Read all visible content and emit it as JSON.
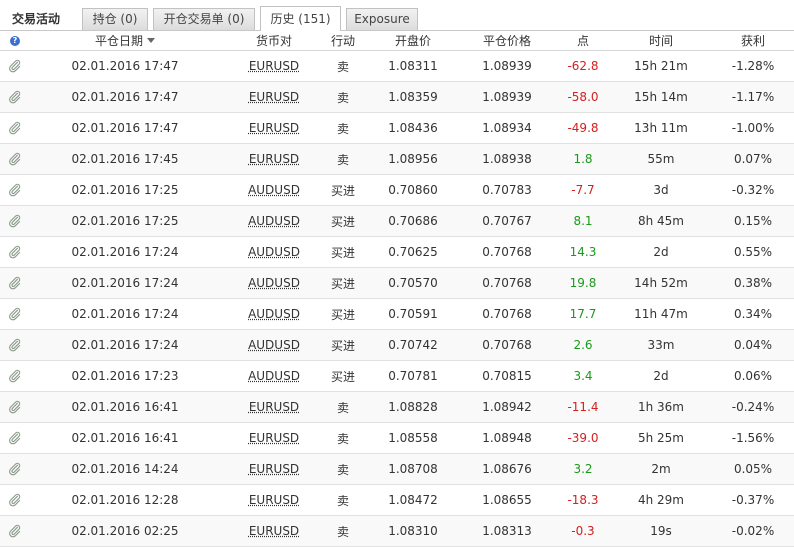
{
  "tabs": {
    "title": "交易活动",
    "items": [
      {
        "label": "持仓 (0)"
      },
      {
        "label": "开仓交易单 (0)"
      },
      {
        "label": "历史 (151)"
      },
      {
        "label": "Exposure"
      }
    ],
    "active_index": 2
  },
  "columns": {
    "close_date": "平仓日期",
    "pair": "货币对",
    "action": "行动",
    "open_price": "开盘价",
    "close_price": "平仓价格",
    "points": "点",
    "time": "时间",
    "pl": "获利"
  },
  "colors": {
    "negative": "#d42020",
    "positive": "#1a9a1a"
  },
  "rows": [
    {
      "date": "02.01.2016 17:47",
      "pair": "EURUSD",
      "action": "卖",
      "open": "1.08311",
      "close": "1.08939",
      "points": "-62.8",
      "time": "15h 21m",
      "pl": "-1.28%"
    },
    {
      "date": "02.01.2016 17:47",
      "pair": "EURUSD",
      "action": "卖",
      "open": "1.08359",
      "close": "1.08939",
      "points": "-58.0",
      "time": "15h 14m",
      "pl": "-1.17%"
    },
    {
      "date": "02.01.2016 17:47",
      "pair": "EURUSD",
      "action": "卖",
      "open": "1.08436",
      "close": "1.08934",
      "points": "-49.8",
      "time": "13h 11m",
      "pl": "-1.00%"
    },
    {
      "date": "02.01.2016 17:45",
      "pair": "EURUSD",
      "action": "卖",
      "open": "1.08956",
      "close": "1.08938",
      "points": "1.8",
      "time": "55m",
      "pl": "0.07%"
    },
    {
      "date": "02.01.2016 17:25",
      "pair": "AUDUSD",
      "action": "买进",
      "open": "0.70860",
      "close": "0.70783",
      "points": "-7.7",
      "time": "3d",
      "pl": "-0.32%"
    },
    {
      "date": "02.01.2016 17:25",
      "pair": "AUDUSD",
      "action": "买进",
      "open": "0.70686",
      "close": "0.70767",
      "points": "8.1",
      "time": "8h 45m",
      "pl": "0.15%"
    },
    {
      "date": "02.01.2016 17:24",
      "pair": "AUDUSD",
      "action": "买进",
      "open": "0.70625",
      "close": "0.70768",
      "points": "14.3",
      "time": "2d",
      "pl": "0.55%"
    },
    {
      "date": "02.01.2016 17:24",
      "pair": "AUDUSD",
      "action": "买进",
      "open": "0.70570",
      "close": "0.70768",
      "points": "19.8",
      "time": "14h 52m",
      "pl": "0.38%"
    },
    {
      "date": "02.01.2016 17:24",
      "pair": "AUDUSD",
      "action": "买进",
      "open": "0.70591",
      "close": "0.70768",
      "points": "17.7",
      "time": "11h 47m",
      "pl": "0.34%"
    },
    {
      "date": "02.01.2016 17:24",
      "pair": "AUDUSD",
      "action": "买进",
      "open": "0.70742",
      "close": "0.70768",
      "points": "2.6",
      "time": "33m",
      "pl": "0.04%"
    },
    {
      "date": "02.01.2016 17:23",
      "pair": "AUDUSD",
      "action": "买进",
      "open": "0.70781",
      "close": "0.70815",
      "points": "3.4",
      "time": "2d",
      "pl": "0.06%"
    },
    {
      "date": "02.01.2016 16:41",
      "pair": "EURUSD",
      "action": "卖",
      "open": "1.08828",
      "close": "1.08942",
      "points": "-11.4",
      "time": "1h 36m",
      "pl": "-0.24%"
    },
    {
      "date": "02.01.2016 16:41",
      "pair": "EURUSD",
      "action": "卖",
      "open": "1.08558",
      "close": "1.08948",
      "points": "-39.0",
      "time": "5h 25m",
      "pl": "-1.56%"
    },
    {
      "date": "02.01.2016 14:24",
      "pair": "EURUSD",
      "action": "卖",
      "open": "1.08708",
      "close": "1.08676",
      "points": "3.2",
      "time": "2m",
      "pl": "0.05%"
    },
    {
      "date": "02.01.2016 12:28",
      "pair": "EURUSD",
      "action": "卖",
      "open": "1.08472",
      "close": "1.08655",
      "points": "-18.3",
      "time": "4h 29m",
      "pl": "-0.37%"
    },
    {
      "date": "02.01.2016 02:25",
      "pair": "EURUSD",
      "action": "卖",
      "open": "1.08310",
      "close": "1.08313",
      "points": "-0.3",
      "time": "19s",
      "pl": "-0.02%"
    }
  ]
}
